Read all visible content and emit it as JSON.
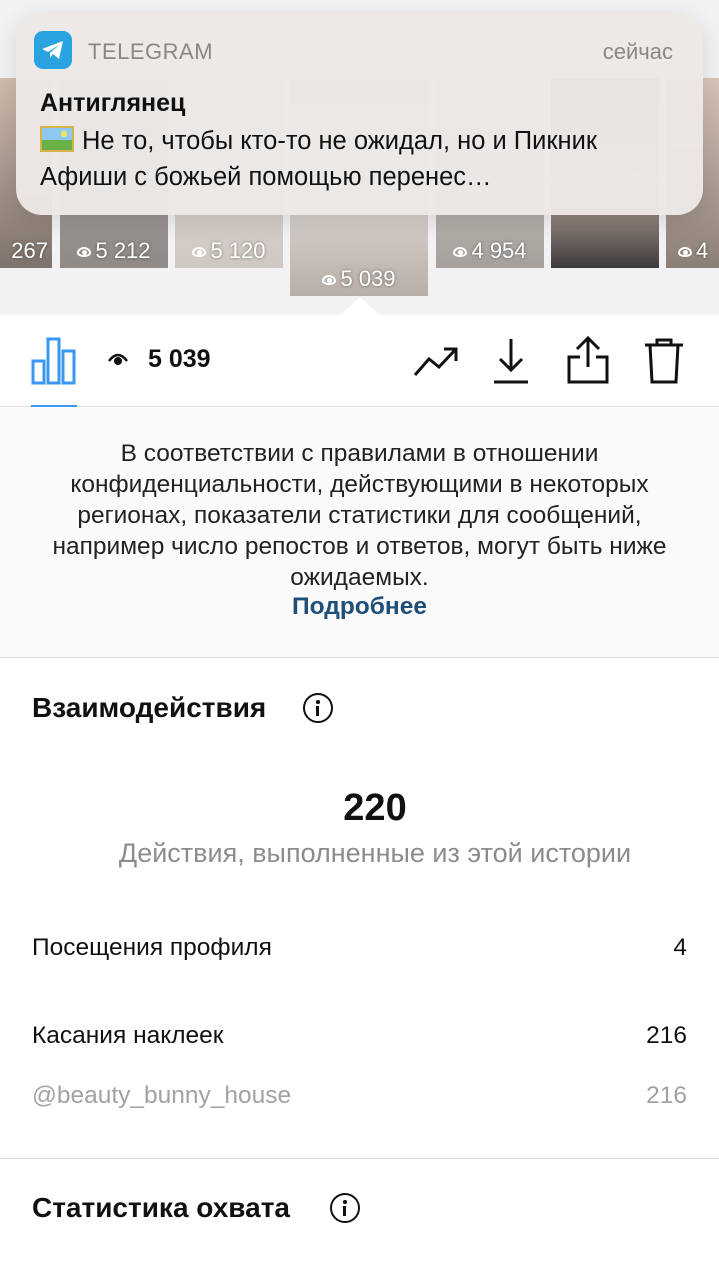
{
  "notification": {
    "app_name": "TELEGRAM",
    "time": "сейчас",
    "title": "Антиглянец",
    "message": "Не то, чтобы кто-то не ожидал, но и Пикник Афиши с божьей помощью перенес…",
    "app_icon": "telegram-icon",
    "message_emoji": "framed-picture-emoji"
  },
  "stories": [
    {
      "views": "267"
    },
    {
      "views": "5 212"
    },
    {
      "views": "5 120"
    },
    {
      "views": "5 039",
      "selected": true
    },
    {
      "views": "4 954"
    },
    {
      "views": ""
    },
    {
      "views": "4"
    }
  ],
  "toolbar": {
    "views": "5 039",
    "icons": [
      "bar-chart-icon",
      "eye-icon",
      "trending-icon",
      "download-icon",
      "share-icon",
      "trash-icon"
    ],
    "accent_color": "#3897f0"
  },
  "notice": {
    "text": "В соответствии с правилами в отношении конфиденциальности, действующими в некоторых регионах, показатели статистики для сообщений, например число репостов и ответов, могут быть ниже ожидаемых.",
    "link": "Подробнее",
    "link_color": "#1f4e79"
  },
  "interactions": {
    "title": "Взаимодействия",
    "total": "220",
    "subtitle": "Действия, выполненные из этой истории",
    "rows": [
      {
        "label": "Посещения профиля",
        "value": "4"
      },
      {
        "label": "Касания наклеек",
        "value": "216"
      },
      {
        "label": "@beauty_bunny_house",
        "value": "216"
      }
    ]
  },
  "reach": {
    "title": "Статистика охвата"
  }
}
